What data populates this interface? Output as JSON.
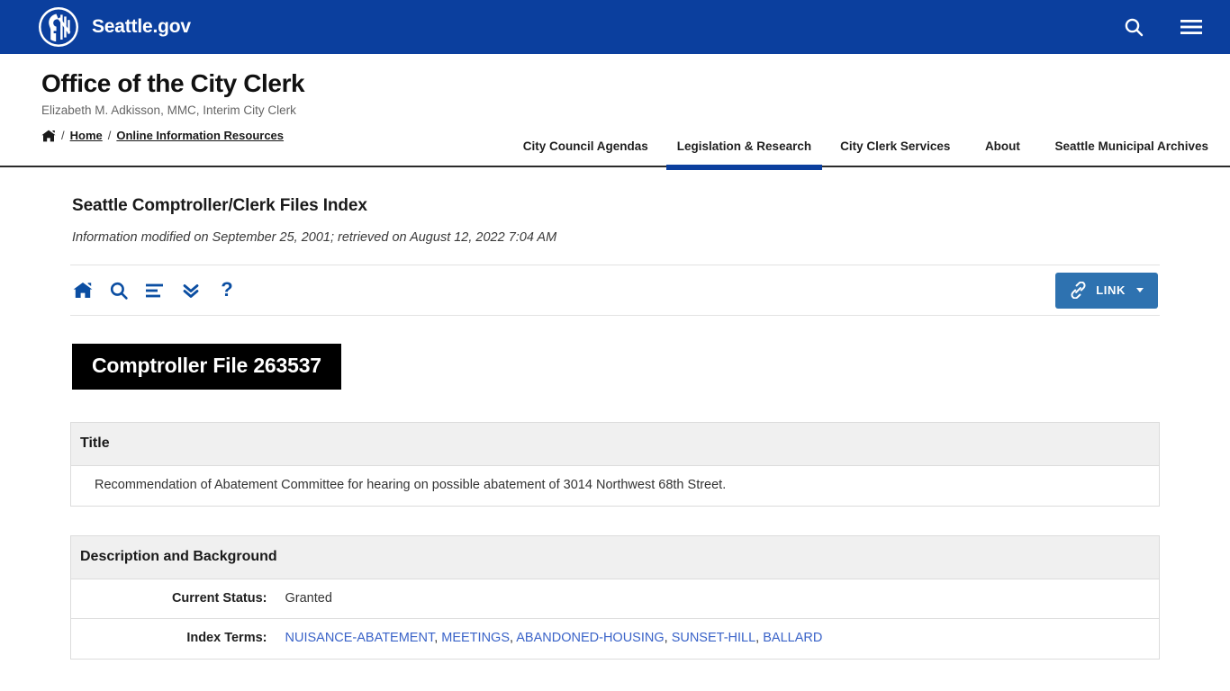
{
  "topbar": {
    "brand_label": "Seattle.gov",
    "logo_icon": "seattle-city-seal-icon",
    "search_icon": "search-icon",
    "menu_icon": "hamburger-menu-icon",
    "background_color": "#0b3f9e"
  },
  "masthead": {
    "title": "Office of the City Clerk",
    "subtitle": "Elizabeth M. Adkisson, MMC, Interim City Clerk",
    "breadcrumb": {
      "home_icon": "home-icon",
      "separator": "/",
      "items": [
        {
          "label": "Home"
        },
        {
          "label": "Online Information Resources"
        }
      ]
    },
    "nav": [
      {
        "label": "City Council Agendas",
        "active": false
      },
      {
        "label": "Legislation & Research",
        "active": true
      },
      {
        "label": "City Clerk Services",
        "active": false
      },
      {
        "label": "About",
        "active": false
      },
      {
        "label": "Seattle Municipal Archives",
        "active": false
      }
    ],
    "active_underline_color": "#0b3f9e"
  },
  "page": {
    "title": "Seattle Comptroller/Clerk Files Index",
    "meta": "Information modified on September 25, 2001; retrieved on August 12, 2022 7:04 AM",
    "file_badge": "Comptroller File 263537"
  },
  "toolbar": {
    "icons": [
      {
        "name": "home-icon",
        "glyph": "home"
      },
      {
        "name": "search-icon",
        "glyph": "magnifier"
      },
      {
        "name": "index-list-icon",
        "glyph": "align-left"
      },
      {
        "name": "jump-down-icon",
        "glyph": "double-chevron-down"
      },
      {
        "name": "help-icon",
        "glyph": "?"
      }
    ],
    "icon_color": "#0b4ea2",
    "link_button": {
      "label": "LINK",
      "icon": "chain-link-icon",
      "caret": "caret-down-icon",
      "background_color": "#2e72b0"
    }
  },
  "tables": [
    {
      "section": "Title",
      "rows": [
        {
          "type": "full",
          "value": "Recommendation of Abatement Committee for hearing on possible abatement of 3014 Northwest 68th Street."
        }
      ]
    },
    {
      "section": "Description and Background",
      "rows": [
        {
          "type": "pair",
          "label": "Current Status:",
          "value": "Granted"
        },
        {
          "type": "terms",
          "label": "Index Terms:",
          "terms": [
            "NUISANCE-ABATEMENT",
            "MEETINGS",
            "ABANDONED-HOUSING",
            "SUNSET-HILL",
            "BALLARD"
          ],
          "link_color": "#3a63c8"
        }
      ]
    }
  ]
}
